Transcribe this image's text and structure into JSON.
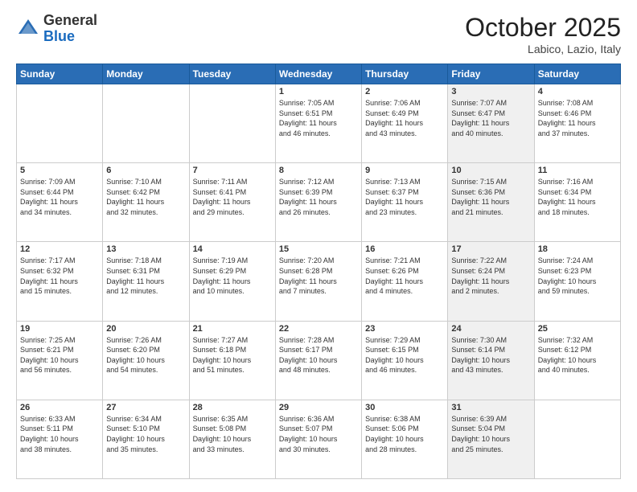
{
  "header": {
    "logo_general": "General",
    "logo_blue": "Blue",
    "month_title": "October 2025",
    "location": "Labico, Lazio, Italy"
  },
  "days_of_week": [
    "Sunday",
    "Monday",
    "Tuesday",
    "Wednesday",
    "Thursday",
    "Friday",
    "Saturday"
  ],
  "weeks": [
    [
      {
        "day": "",
        "info": "",
        "shaded": false
      },
      {
        "day": "",
        "info": "",
        "shaded": false
      },
      {
        "day": "",
        "info": "",
        "shaded": false
      },
      {
        "day": "1",
        "info": "Sunrise: 7:05 AM\nSunset: 6:51 PM\nDaylight: 11 hours\nand 46 minutes.",
        "shaded": false
      },
      {
        "day": "2",
        "info": "Sunrise: 7:06 AM\nSunset: 6:49 PM\nDaylight: 11 hours\nand 43 minutes.",
        "shaded": false
      },
      {
        "day": "3",
        "info": "Sunrise: 7:07 AM\nSunset: 6:47 PM\nDaylight: 11 hours\nand 40 minutes.",
        "shaded": true
      },
      {
        "day": "4",
        "info": "Sunrise: 7:08 AM\nSunset: 6:46 PM\nDaylight: 11 hours\nand 37 minutes.",
        "shaded": false
      }
    ],
    [
      {
        "day": "5",
        "info": "Sunrise: 7:09 AM\nSunset: 6:44 PM\nDaylight: 11 hours\nand 34 minutes.",
        "shaded": false
      },
      {
        "day": "6",
        "info": "Sunrise: 7:10 AM\nSunset: 6:42 PM\nDaylight: 11 hours\nand 32 minutes.",
        "shaded": false
      },
      {
        "day": "7",
        "info": "Sunrise: 7:11 AM\nSunset: 6:41 PM\nDaylight: 11 hours\nand 29 minutes.",
        "shaded": false
      },
      {
        "day": "8",
        "info": "Sunrise: 7:12 AM\nSunset: 6:39 PM\nDaylight: 11 hours\nand 26 minutes.",
        "shaded": false
      },
      {
        "day": "9",
        "info": "Sunrise: 7:13 AM\nSunset: 6:37 PM\nDaylight: 11 hours\nand 23 minutes.",
        "shaded": false
      },
      {
        "day": "10",
        "info": "Sunrise: 7:15 AM\nSunset: 6:36 PM\nDaylight: 11 hours\nand 21 minutes.",
        "shaded": true
      },
      {
        "day": "11",
        "info": "Sunrise: 7:16 AM\nSunset: 6:34 PM\nDaylight: 11 hours\nand 18 minutes.",
        "shaded": false
      }
    ],
    [
      {
        "day": "12",
        "info": "Sunrise: 7:17 AM\nSunset: 6:32 PM\nDaylight: 11 hours\nand 15 minutes.",
        "shaded": false
      },
      {
        "day": "13",
        "info": "Sunrise: 7:18 AM\nSunset: 6:31 PM\nDaylight: 11 hours\nand 12 minutes.",
        "shaded": false
      },
      {
        "day": "14",
        "info": "Sunrise: 7:19 AM\nSunset: 6:29 PM\nDaylight: 11 hours\nand 10 minutes.",
        "shaded": false
      },
      {
        "day": "15",
        "info": "Sunrise: 7:20 AM\nSunset: 6:28 PM\nDaylight: 11 hours\nand 7 minutes.",
        "shaded": false
      },
      {
        "day": "16",
        "info": "Sunrise: 7:21 AM\nSunset: 6:26 PM\nDaylight: 11 hours\nand 4 minutes.",
        "shaded": false
      },
      {
        "day": "17",
        "info": "Sunrise: 7:22 AM\nSunset: 6:24 PM\nDaylight: 11 hours\nand 2 minutes.",
        "shaded": true
      },
      {
        "day": "18",
        "info": "Sunrise: 7:24 AM\nSunset: 6:23 PM\nDaylight: 10 hours\nand 59 minutes.",
        "shaded": false
      }
    ],
    [
      {
        "day": "19",
        "info": "Sunrise: 7:25 AM\nSunset: 6:21 PM\nDaylight: 10 hours\nand 56 minutes.",
        "shaded": false
      },
      {
        "day": "20",
        "info": "Sunrise: 7:26 AM\nSunset: 6:20 PM\nDaylight: 10 hours\nand 54 minutes.",
        "shaded": false
      },
      {
        "day": "21",
        "info": "Sunrise: 7:27 AM\nSunset: 6:18 PM\nDaylight: 10 hours\nand 51 minutes.",
        "shaded": false
      },
      {
        "day": "22",
        "info": "Sunrise: 7:28 AM\nSunset: 6:17 PM\nDaylight: 10 hours\nand 48 minutes.",
        "shaded": false
      },
      {
        "day": "23",
        "info": "Sunrise: 7:29 AM\nSunset: 6:15 PM\nDaylight: 10 hours\nand 46 minutes.",
        "shaded": false
      },
      {
        "day": "24",
        "info": "Sunrise: 7:30 AM\nSunset: 6:14 PM\nDaylight: 10 hours\nand 43 minutes.",
        "shaded": true
      },
      {
        "day": "25",
        "info": "Sunrise: 7:32 AM\nSunset: 6:12 PM\nDaylight: 10 hours\nand 40 minutes.",
        "shaded": false
      }
    ],
    [
      {
        "day": "26",
        "info": "Sunrise: 6:33 AM\nSunset: 5:11 PM\nDaylight: 10 hours\nand 38 minutes.",
        "shaded": false
      },
      {
        "day": "27",
        "info": "Sunrise: 6:34 AM\nSunset: 5:10 PM\nDaylight: 10 hours\nand 35 minutes.",
        "shaded": false
      },
      {
        "day": "28",
        "info": "Sunrise: 6:35 AM\nSunset: 5:08 PM\nDaylight: 10 hours\nand 33 minutes.",
        "shaded": false
      },
      {
        "day": "29",
        "info": "Sunrise: 6:36 AM\nSunset: 5:07 PM\nDaylight: 10 hours\nand 30 minutes.",
        "shaded": false
      },
      {
        "day": "30",
        "info": "Sunrise: 6:38 AM\nSunset: 5:06 PM\nDaylight: 10 hours\nand 28 minutes.",
        "shaded": false
      },
      {
        "day": "31",
        "info": "Sunrise: 6:39 AM\nSunset: 5:04 PM\nDaylight: 10 hours\nand 25 minutes.",
        "shaded": true
      },
      {
        "day": "",
        "info": "",
        "shaded": false
      }
    ]
  ]
}
